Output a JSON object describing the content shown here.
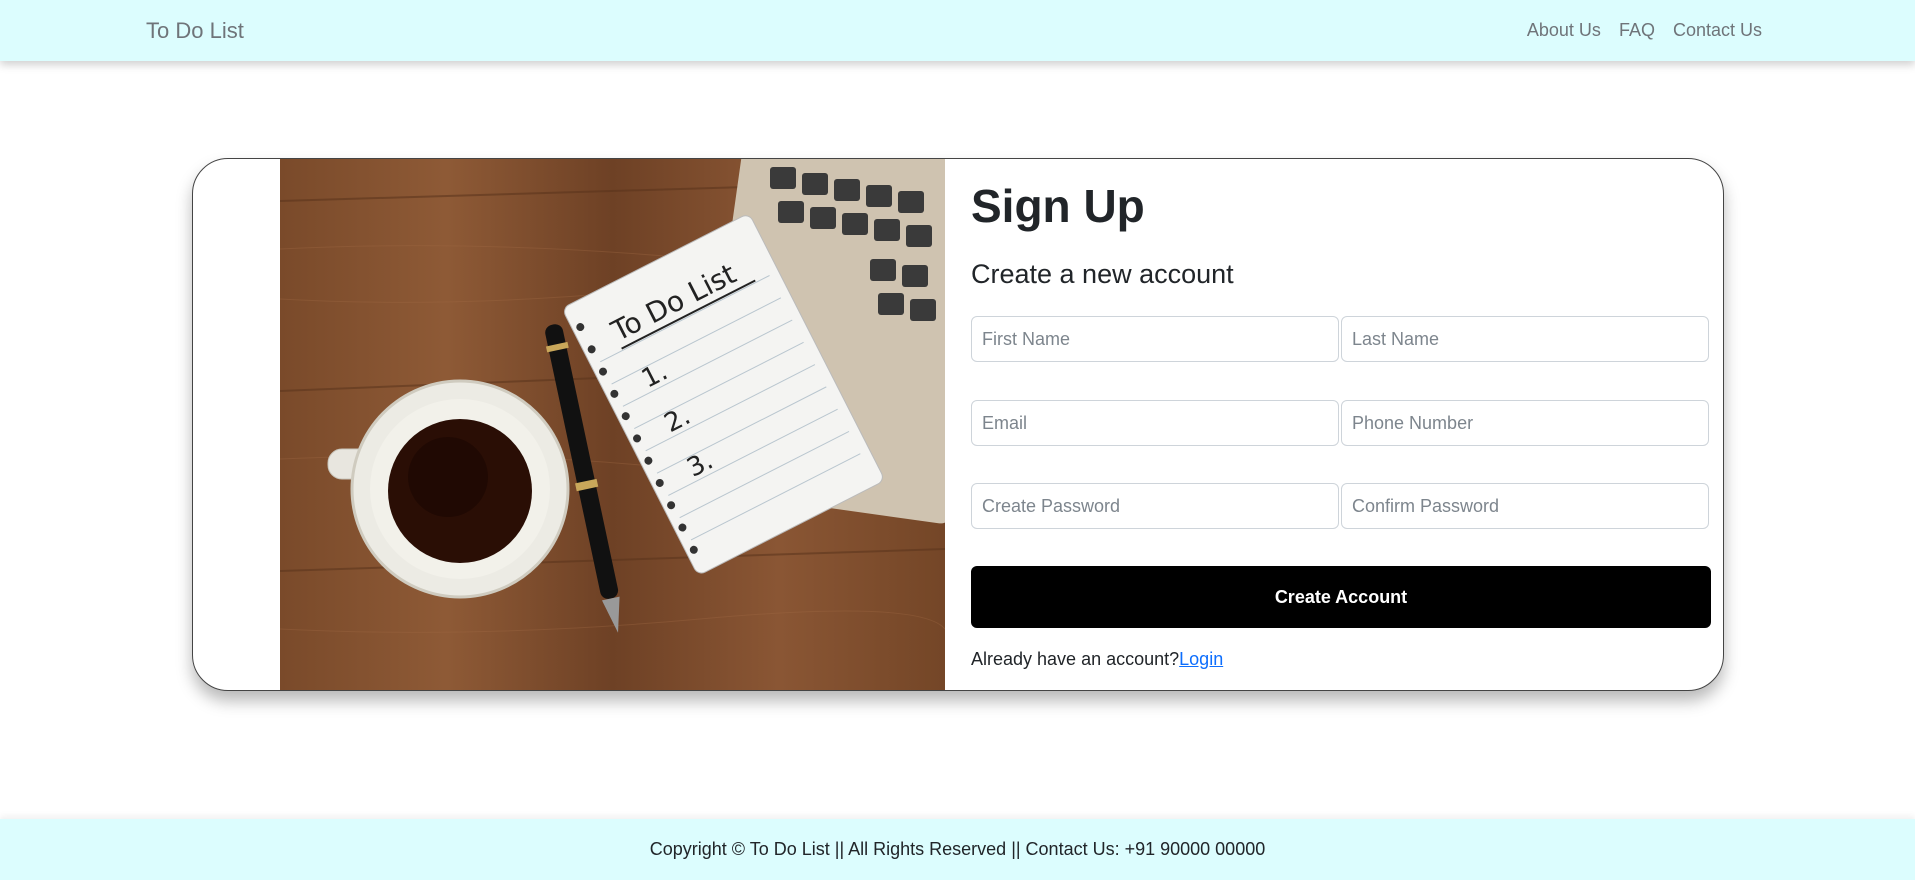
{
  "navbar": {
    "brand": "To Do List",
    "links": [
      "About Us",
      "FAQ",
      "Contact Us"
    ]
  },
  "hero_image": {
    "notepad_text": "To Do List",
    "list_numbers": [
      "1.",
      "2.",
      "3."
    ]
  },
  "signup": {
    "title": "Sign Up",
    "subtitle": "Create a new account",
    "fields": {
      "first_name": "First Name",
      "last_name": "Last Name",
      "email": "Email",
      "phone": "Phone Number",
      "password": "Create Password",
      "confirm_password": "Confirm Password"
    },
    "submit_label": "Create Account",
    "login_prompt": "Already have an account?",
    "login_link": "Login"
  },
  "footer": {
    "text": "Copyright © To Do List || All Rights Reserved || Contact Us: +91 90000 00000"
  },
  "colors": {
    "navbar_bg": "#dcfdfe",
    "button_bg": "#000000",
    "link": "#0d6efd"
  }
}
